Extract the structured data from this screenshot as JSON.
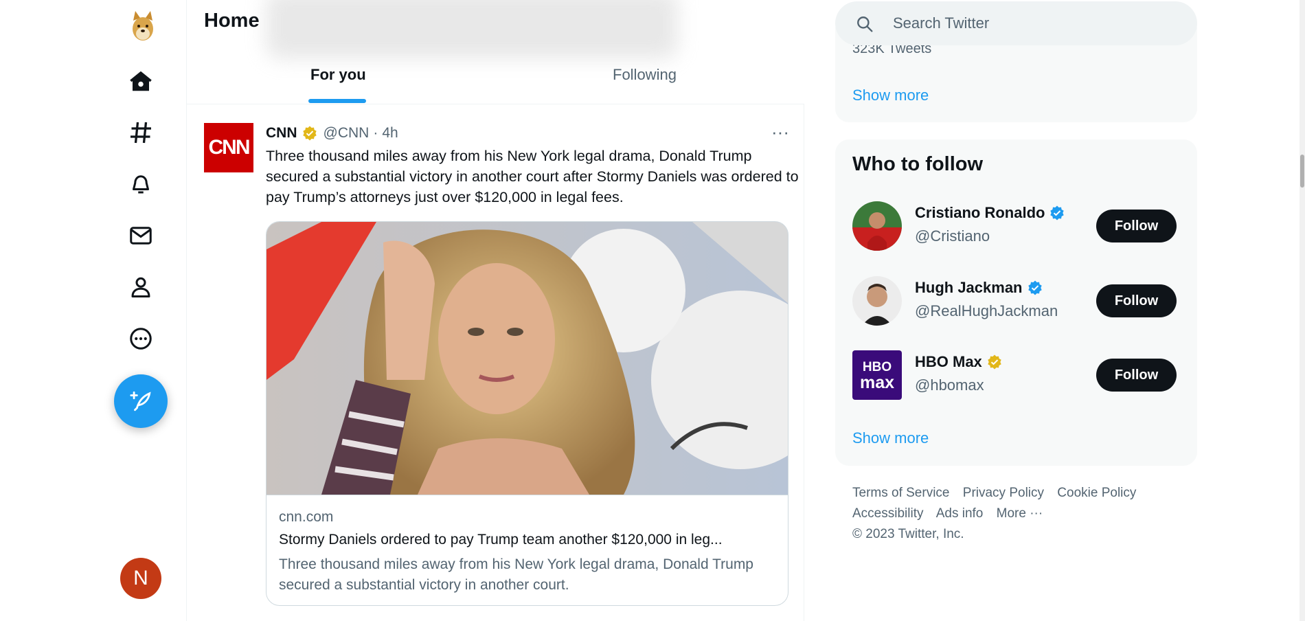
{
  "nav": {
    "items": [
      "Home",
      "Explore",
      "Notifications",
      "Messages",
      "Profile",
      "More"
    ],
    "avatar_initial": "N"
  },
  "header": {
    "title": "Home",
    "tabs": [
      {
        "label": "For you",
        "active": true
      },
      {
        "label": "Following",
        "active": false
      }
    ]
  },
  "tweet": {
    "avatar_text": "CNN",
    "name": "CNN",
    "handle": "@CNN",
    "separator": "·",
    "time": "4h",
    "more": "···",
    "text": "Three thousand miles away from his New York legal drama, Donald Trump secured a substantial victory in another court after Stormy Daniels was ordered to pay Trump’s attorneys just over $120,000 in legal fees.",
    "card": {
      "domain": "cnn.com",
      "title": "Stormy Daniels ordered to pay Trump team another $120,000 in leg...",
      "description": "Three thousand miles away from his New York legal drama, Donald Trump secured a substantial victory in another court."
    }
  },
  "search": {
    "placeholder": "Search Twitter"
  },
  "trends": {
    "cut_text": "323K Tweets",
    "show_more": "Show more"
  },
  "who_to_follow": {
    "title": "Who to follow",
    "accounts": [
      {
        "name": "Cristiano Ronaldo",
        "handle": "@Cristiano",
        "badge": "blue",
        "button": "Follow"
      },
      {
        "name": "Hugh Jackman",
        "handle": "@RealHughJackman",
        "badge": "blue",
        "button": "Follow"
      },
      {
        "name": "HBO Max",
        "handle": "@hbomax",
        "badge": "gold",
        "button": "Follow",
        "avatar_lines": [
          "HBO",
          "max"
        ]
      }
    ],
    "show_more": "Show more"
  },
  "footer": {
    "links": [
      "Terms of Service",
      "Privacy Policy",
      "Cookie Policy",
      "Accessibility",
      "Ads info",
      "More ···"
    ],
    "copyright": "© 2023 Twitter, Inc."
  },
  "colors": {
    "accent": "#1d9bf0",
    "verified_gold": "#e2b719",
    "text": "#0f1419",
    "muted": "#536471"
  }
}
